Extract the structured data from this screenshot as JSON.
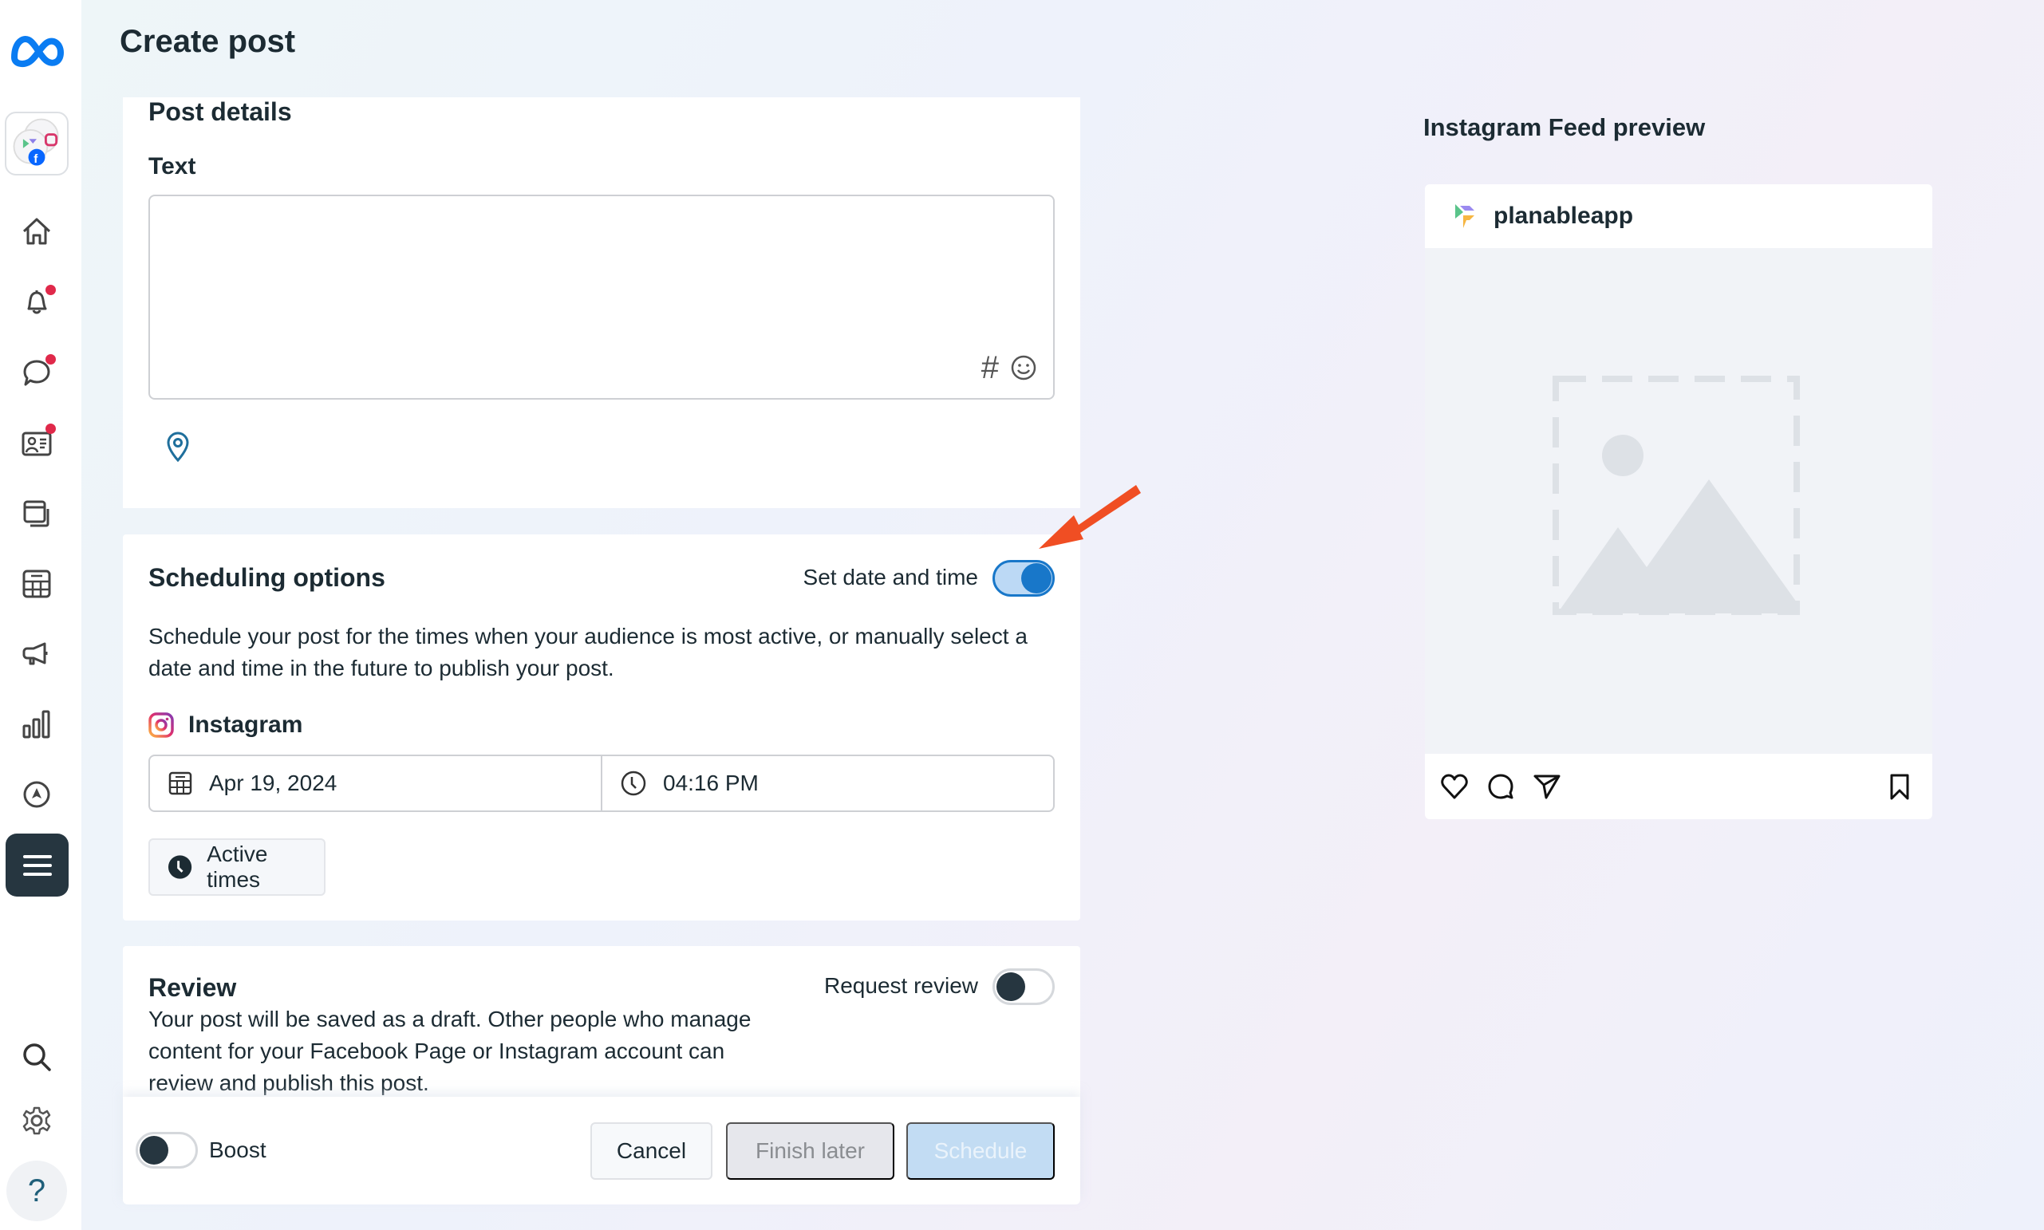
{
  "page": {
    "title": "Create post"
  },
  "sidebar": {
    "items": [
      {
        "name": "home",
        "icon": "home-icon",
        "badge": false
      },
      {
        "name": "notifications",
        "icon": "bell-icon",
        "badge": true
      },
      {
        "name": "inbox",
        "icon": "chat-bubble-icon",
        "badge": true
      },
      {
        "name": "contacts",
        "icon": "id-card-icon",
        "badge": true
      },
      {
        "name": "content",
        "icon": "stacked-pages-icon",
        "badge": false
      },
      {
        "name": "planner",
        "icon": "calendar-grid-icon",
        "badge": false
      },
      {
        "name": "ads",
        "icon": "megaphone-icon",
        "badge": false
      },
      {
        "name": "insights",
        "icon": "bar-chart-icon",
        "badge": false
      },
      {
        "name": "monetization",
        "icon": "compass-icon",
        "badge": false
      },
      {
        "name": "all-tools",
        "icon": "hamburger-menu-icon",
        "badge": false,
        "active": true
      }
    ],
    "bottom": [
      {
        "name": "search",
        "icon": "search-icon"
      },
      {
        "name": "settings",
        "icon": "gear-icon"
      },
      {
        "name": "help",
        "icon": "help-icon",
        "label": "?"
      }
    ],
    "badge_color": "#e0294a"
  },
  "post_details": {
    "heading": "Post details",
    "text_label": "Text",
    "text_value": "",
    "icons": [
      "hashtag-icon",
      "emoji-icon",
      "location-pin-icon"
    ],
    "hash_glyph": "#"
  },
  "scheduling": {
    "heading": "Scheduling options",
    "toggle_label": "Set date and time",
    "toggle_on": true,
    "description": "Schedule your post for the times when your audience is most active, or manually select a date and time in the future to publish your post.",
    "platform": "Instagram",
    "date": "Apr 19, 2024",
    "time": "04:16 PM",
    "active_times_label": "Active times",
    "accent_color": "#1877c9"
  },
  "review": {
    "heading": "Review",
    "toggle_label": "Request review",
    "toggle_on": false,
    "description": "Your post will be saved as a draft. Other people who manage content for your Facebook Page or Instagram account can review and publish this post."
  },
  "footer": {
    "boost_label": "Boost",
    "boost_on": false,
    "cancel_label": "Cancel",
    "finish_later_label": "Finish later",
    "schedule_label": "Schedule"
  },
  "preview": {
    "title": "Instagram Feed preview",
    "account_name": "planableapp",
    "actions": [
      "heart-icon",
      "comment-icon",
      "share-icon",
      "bookmark-icon"
    ]
  },
  "annotation": {
    "arrow_color": "#f04e23"
  }
}
